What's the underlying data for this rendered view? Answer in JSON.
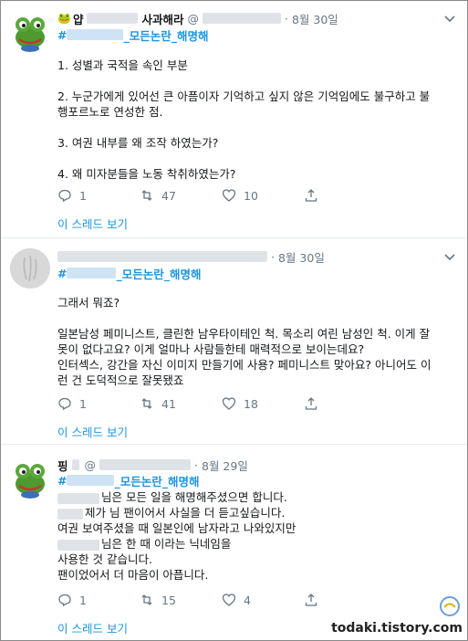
{
  "tweets": [
    {
      "name": "얍",
      "name_suffix": "사과해라",
      "handle_prefix": "@",
      "time": "8월 30일",
      "tag_prefix": "#",
      "tag_suffix": "_모든논란_해명해",
      "lines": [
        "1. 성별과 국적을 속인 부분",
        "",
        "2. 누군가에게 있어선 큰 아픔이자 기억하고 싶지 않은 기억임에도 불구하고 불",
        "행포르노로 연성한 점.",
        "",
        "3. 여권 내부를 왜 조작 하였는가?",
        "",
        "4. 왜 미자분들을 노동 착취하였는가?"
      ],
      "reply_count": "1",
      "retweet_count": "47",
      "like_count": "10",
      "thread_label": "이 스레드 보기"
    },
    {
      "time": "8월 30일",
      "tag_prefix": "#",
      "tag_suffix": "_모든논란_해명해",
      "lines": [
        "그래서 뭐죠?",
        "",
        "일본남성 페미니스트, 클린한 남우타이테인 척. 목소리 여린 남성인 척. 이게 잘",
        "못이 없다고요? 이게 얼마나 사람들한테 매력적으로 보이는데요?",
        "인터섹스, 강간을 자신 이미지 만들기에 사용? 페미니스트 맞아요? 아니어도 이",
        "런 건 도덕적으로 잘못됐죠"
      ],
      "reply_count": "1",
      "retweet_count": "41",
      "like_count": "18",
      "thread_label": "이 스레드 보기"
    },
    {
      "name": "핑",
      "handle_prefix": "@",
      "time": "8월 29일",
      "tag_prefix": "#",
      "tag_suffix": "_모든논란_해명해",
      "lines": [
        "님은 모든 일을 해명해주셨으면 합니다.",
        "제가 님 팬이어서 사실을 더 듣고싶습니다.",
        "여권 보여주셨을 때 일본인에 남자라고 나와있지만",
        "님은 한 때 이라는 닉네임을",
        "사용한 것 같습니다.",
        "팬이었어서 더 마음이 아픕니다."
      ],
      "reply_count": "1",
      "retweet_count": "15",
      "like_count": "4",
      "thread_label": "이 스레드 보기"
    }
  ],
  "watermark": "todaki.tistory.com",
  "colors": {
    "link": "#1b95e0",
    "muted": "#657786",
    "divider": "#e6ecf0",
    "text": "#14171a"
  },
  "icons": [
    "frog-avatar-icon",
    "user-avatar-icon",
    "chevron-down-icon",
    "reply-icon",
    "retweet-icon",
    "like-icon",
    "share-icon"
  ]
}
